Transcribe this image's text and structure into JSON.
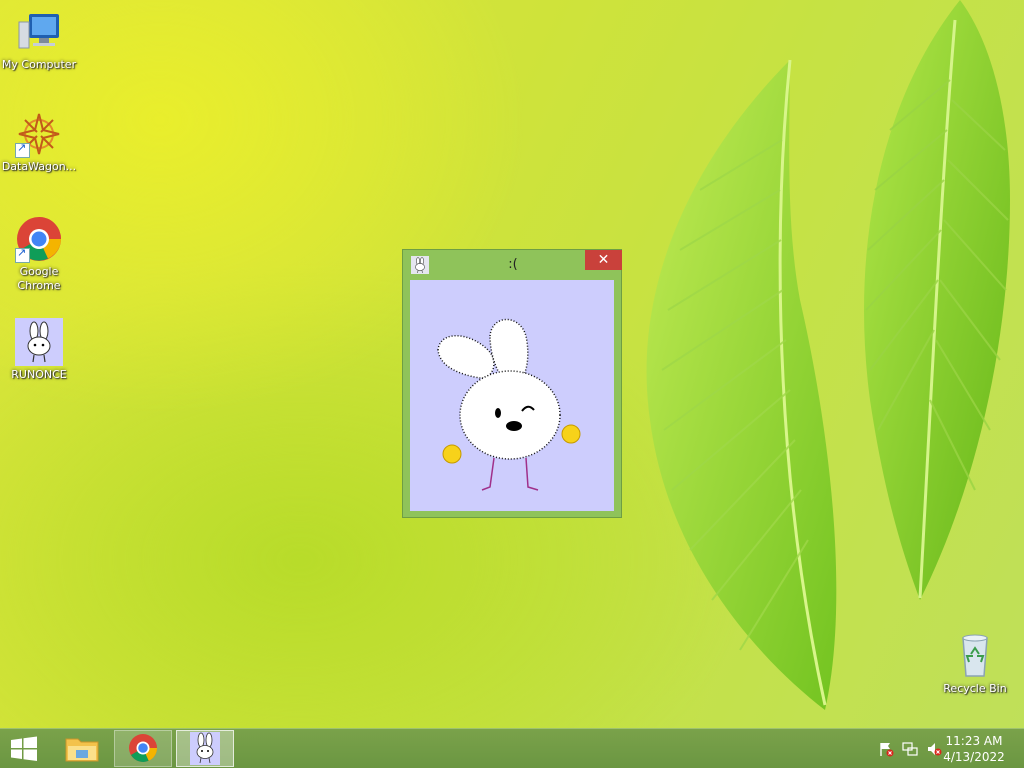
{
  "desktop": {
    "icons": [
      {
        "label": "My Computer"
      },
      {
        "label": "DataWagon..."
      },
      {
        "label": "Google Chrome"
      },
      {
        "label": "RUNONCE"
      },
      {
        "label": "Recycle Bin"
      }
    ]
  },
  "window": {
    "title": ":(",
    "close_glyph": "✕"
  },
  "taskbar": {
    "items": [
      "start-button",
      "file-explorer",
      "google-chrome",
      "runonce"
    ]
  },
  "tray": {
    "time": "11:23 AM",
    "date": "4/13/2022",
    "icons": [
      "action-center-flag-icon",
      "network-icon",
      "volume-muted-icon"
    ]
  },
  "colors": {
    "window_frame": "#8fc35a",
    "window_client": "#cdcdfd",
    "close_button": "#c9413b",
    "taskbar": "#6b9642"
  }
}
